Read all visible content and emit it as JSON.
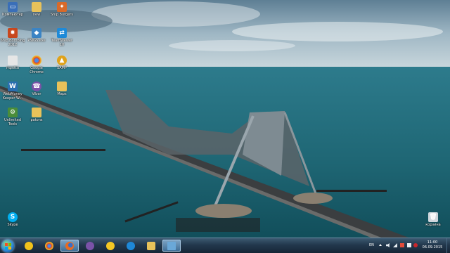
{
  "desktop": {
    "icons": [
      {
        "label": "Компьютер",
        "icon": "computer-icon",
        "color": "#3a6fb8"
      },
      {
        "label": "new",
        "icon": "folder-icon",
        "color": "#e8c25a"
      },
      {
        "label": "Ship Burgers",
        "icon": "game-icon",
        "color": "#d86a2a"
      },
      {
        "label": "Ship Bombing 2012",
        "icon": "game-icon",
        "color": "#c8471e"
      },
      {
        "label": "PSIGS.exe",
        "icon": "app-icon",
        "color": "#3b84c4"
      },
      {
        "label": "TeamViewer 10",
        "icon": "teamviewer-icon",
        "color": "#1e8ad8"
      },
      {
        "label": "mpetto",
        "icon": "document-icon",
        "color": "#e6e6e6"
      },
      {
        "label": "Google Chrome",
        "icon": "chrome-icon",
        "color": "#d9372f"
      },
      {
        "label": "SAMP",
        "icon": "samp-icon",
        "color": "#e0a21a"
      },
      {
        "label": "WebMoney Keeper W...",
        "icon": "webmoney-icon",
        "color": "#2a6fb0"
      },
      {
        "label": "Viber",
        "icon": "viber-icon",
        "color": "#7b52a8"
      },
      {
        "label": "Maps",
        "icon": "folder-icon",
        "color": "#e8c25a"
      },
      {
        "label": "Unlimited Tools",
        "icon": "tools-icon",
        "color": "#4a8d3a"
      },
      {
        "label": "patons",
        "icon": "folder-icon",
        "color": "#e8c25a"
      },
      {
        "label": "Skype",
        "icon": "skype-icon",
        "color": "#00aff0"
      },
      {
        "label": "корзина",
        "icon": "recycle-bin-icon",
        "color": "#cfd6dc"
      }
    ]
  },
  "taskbar": {
    "apps": [
      {
        "name": "messenger-taskbar-button",
        "icon": "messenger-icon",
        "color": "#f2c21b",
        "active": false
      },
      {
        "name": "chrome-taskbar-button",
        "icon": "chrome-icon",
        "color": "#d9372f",
        "active": false
      },
      {
        "name": "firefox-taskbar-button",
        "icon": "firefox-icon",
        "color": "#e86b1f",
        "active": true
      },
      {
        "name": "viber-taskbar-button",
        "icon": "viber-icon",
        "color": "#7b52a8",
        "active": false
      },
      {
        "name": "smiley-taskbar-button",
        "icon": "smiley-icon",
        "color": "#f5c724",
        "active": false
      },
      {
        "name": "ie-taskbar-button",
        "icon": "internet-explorer-icon",
        "color": "#1e88d8",
        "active": false
      },
      {
        "name": "explorer-taskbar-button",
        "icon": "folder-icon",
        "color": "#e8c25a",
        "active": false
      },
      {
        "name": "desktop-app-taskbar-button",
        "icon": "monitor-icon",
        "color": "#6aa8d8",
        "active": true
      }
    ],
    "tray": {
      "language": "EN",
      "time": "11:00",
      "date": "06.09.2015"
    }
  }
}
